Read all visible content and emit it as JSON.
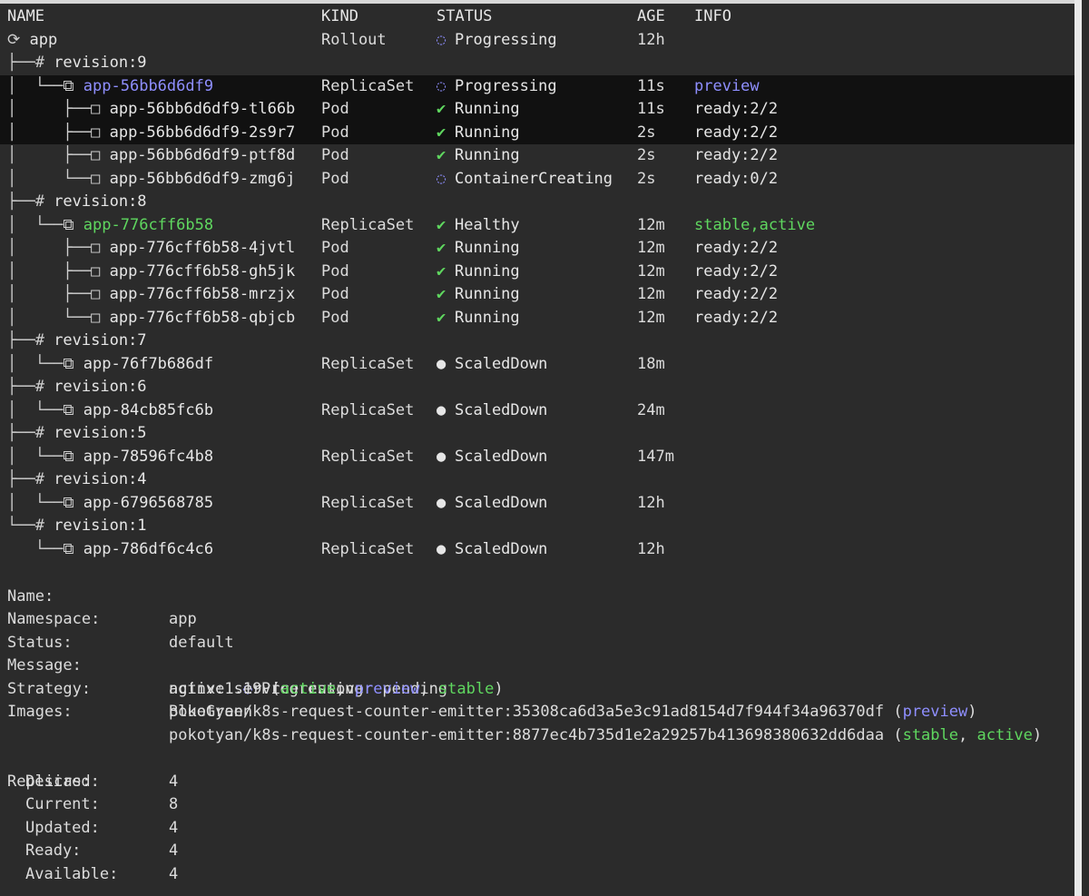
{
  "columns": {
    "name": "NAME",
    "kind": "KIND",
    "status": "STATUS",
    "age": "AGE",
    "info": "INFO"
  },
  "tree_rows": [
    {
      "prefix": "⟳ ",
      "name": "app",
      "kind": "Rollout",
      "status_icon": "◌",
      "status_icon_name": "progress-icon",
      "status": "Progressing",
      "age": "12h",
      "info": "",
      "color": "white"
    },
    {
      "prefix": "├──# ",
      "name": "revision:9",
      "kind": "",
      "status_icon": "",
      "status": "",
      "age": "",
      "info": "",
      "color": "white"
    },
    {
      "prefix": "│  └──⧉ ",
      "name": "app-56bb6d6df9",
      "kind": "ReplicaSet",
      "status_icon": "◌",
      "status_icon_name": "progress-icon",
      "status": "Progressing",
      "age": "11s",
      "info": "preview",
      "color": "blue",
      "info_color": "blue",
      "highlight": true
    },
    {
      "prefix": "│     ├──□ ",
      "name": "app-56bb6d6df9-tl66b",
      "kind": "Pod",
      "status_icon": "✔",
      "status_icon_name": "check-icon",
      "status": "Running",
      "age": "11s",
      "info": "ready:2/2",
      "color": "white",
      "highlight": true
    },
    {
      "prefix": "│     ├──□ ",
      "name": "app-56bb6d6df9-2s9r7",
      "kind": "Pod",
      "status_icon": "✔",
      "status_icon_name": "check-icon",
      "status": "Running",
      "age": "2s",
      "info": "ready:2/2",
      "color": "white",
      "highlight": true
    },
    {
      "prefix": "│     ├──□ ",
      "name": "app-56bb6d6df9-ptf8d",
      "kind": "Pod",
      "status_icon": "✔",
      "status_icon_name": "check-icon",
      "status": "Running",
      "age": "2s",
      "info": "ready:2/2",
      "color": "white"
    },
    {
      "prefix": "│     └──□ ",
      "name": "app-56bb6d6df9-zmg6j",
      "kind": "Pod",
      "status_icon": "◌",
      "status_icon_name": "creating-icon",
      "status": "ContainerCreating",
      "age": "2s",
      "info": "ready:0/2",
      "color": "white"
    },
    {
      "prefix": "├──# ",
      "name": "revision:8",
      "kind": "",
      "status_icon": "",
      "status": "",
      "age": "",
      "info": "",
      "color": "white"
    },
    {
      "prefix": "│  └──⧉ ",
      "name": "app-776cff6b58",
      "kind": "ReplicaSet",
      "status_icon": "✔",
      "status_icon_name": "check-icon",
      "status": "Healthy",
      "age": "12m",
      "info": "stable,active",
      "color": "green",
      "info_color": "green"
    },
    {
      "prefix": "│     ├──□ ",
      "name": "app-776cff6b58-4jvtl",
      "kind": "Pod",
      "status_icon": "✔",
      "status_icon_name": "check-icon",
      "status": "Running",
      "age": "12m",
      "info": "ready:2/2",
      "color": "white"
    },
    {
      "prefix": "│     ├──□ ",
      "name": "app-776cff6b58-gh5jk",
      "kind": "Pod",
      "status_icon": "✔",
      "status_icon_name": "check-icon",
      "status": "Running",
      "age": "12m",
      "info": "ready:2/2",
      "color": "white"
    },
    {
      "prefix": "│     ├──□ ",
      "name": "app-776cff6b58-mrzjx",
      "kind": "Pod",
      "status_icon": "✔",
      "status_icon_name": "check-icon",
      "status": "Running",
      "age": "12m",
      "info": "ready:2/2",
      "color": "white"
    },
    {
      "prefix": "│     └──□ ",
      "name": "app-776cff6b58-qbjcb",
      "kind": "Pod",
      "status_icon": "✔",
      "status_icon_name": "check-icon",
      "status": "Running",
      "age": "12m",
      "info": "ready:2/2",
      "color": "white"
    },
    {
      "prefix": "├──# ",
      "name": "revision:7",
      "kind": "",
      "status_icon": "",
      "status": "",
      "age": "",
      "info": "",
      "color": "white"
    },
    {
      "prefix": "│  └──⧉ ",
      "name": "app-76f7b686df",
      "kind": "ReplicaSet",
      "status_icon": "●",
      "status_icon_name": "dot-icon",
      "status": "ScaledDown",
      "age": "18m",
      "info": "",
      "color": "white"
    },
    {
      "prefix": "├──# ",
      "name": "revision:6",
      "kind": "",
      "status_icon": "",
      "status": "",
      "age": "",
      "info": "",
      "color": "white"
    },
    {
      "prefix": "│  └──⧉ ",
      "name": "app-84cb85fc6b",
      "kind": "ReplicaSet",
      "status_icon": "●",
      "status_icon_name": "dot-icon",
      "status": "ScaledDown",
      "age": "24m",
      "info": "",
      "color": "white"
    },
    {
      "prefix": "├──# ",
      "name": "revision:5",
      "kind": "",
      "status_icon": "",
      "status": "",
      "age": "",
      "info": "",
      "color": "white"
    },
    {
      "prefix": "│  └──⧉ ",
      "name": "app-78596fc4b8",
      "kind": "ReplicaSet",
      "status_icon": "●",
      "status_icon_name": "dot-icon",
      "status": "ScaledDown",
      "age": "147m",
      "info": "",
      "color": "white"
    },
    {
      "prefix": "├──# ",
      "name": "revision:4",
      "kind": "",
      "status_icon": "",
      "status": "",
      "age": "",
      "info": "",
      "color": "white"
    },
    {
      "prefix": "│  └──⧉ ",
      "name": "app-6796568785",
      "kind": "ReplicaSet",
      "status_icon": "●",
      "status_icon_name": "dot-icon",
      "status": "ScaledDown",
      "age": "12h",
      "info": "",
      "color": "white"
    },
    {
      "prefix": "└──# ",
      "name": "revision:1",
      "kind": "",
      "status_icon": "",
      "status": "",
      "age": "",
      "info": "",
      "color": "white"
    },
    {
      "prefix": "   └──⧉ ",
      "name": "app-786df6c4c6",
      "kind": "ReplicaSet",
      "status_icon": "●",
      "status_icon_name": "dot-icon",
      "status": "ScaledDown",
      "age": "12h",
      "info": "",
      "color": "white"
    }
  ],
  "details": {
    "name_label": "Name:",
    "name_value": "app",
    "namespace_label": "Namespace:",
    "namespace_value": "default",
    "status_label": "Status:",
    "status_icon": "◌",
    "status_value": "Progressing",
    "message_label": "Message:",
    "message_value": "active service cutover pending",
    "strategy_label": "Strategy:",
    "strategy_value": "BlueGreen",
    "images_label": "Images:",
    "images": [
      {
        "image": "nginx:1.19",
        "tags": [
          {
            "text": "active",
            "color": "green"
          },
          {
            "text": "preview",
            "color": "blue"
          },
          {
            "text": "stable",
            "color": "green"
          }
        ]
      },
      {
        "image": "pokotyan/k8s-request-counter-emitter:35308ca6d3a5e3c91ad8154d7f944f34a96370df",
        "tags": [
          {
            "text": "preview",
            "color": "blue"
          }
        ]
      },
      {
        "image": "pokotyan/k8s-request-counter-emitter:8877ec4b735d1e2a29257b413698380632dd6daa",
        "tags": [
          {
            "text": "stable",
            "color": "green"
          },
          {
            "text": "active",
            "color": "green"
          }
        ]
      }
    ],
    "replicas_label": "Replicas:",
    "replicas": [
      {
        "label": "Desired:",
        "value": "4"
      },
      {
        "label": "Current:",
        "value": "8"
      },
      {
        "label": "Updated:",
        "value": "4"
      },
      {
        "label": "Ready:",
        "value": "4"
      },
      {
        "label": "Available:",
        "value": "4"
      }
    ]
  },
  "colors": {
    "background": "#2b2b2b",
    "highlight_row": "#111111",
    "blue": "#8f8fff",
    "green": "#5fd75f",
    "text": "#dcdcdc"
  }
}
